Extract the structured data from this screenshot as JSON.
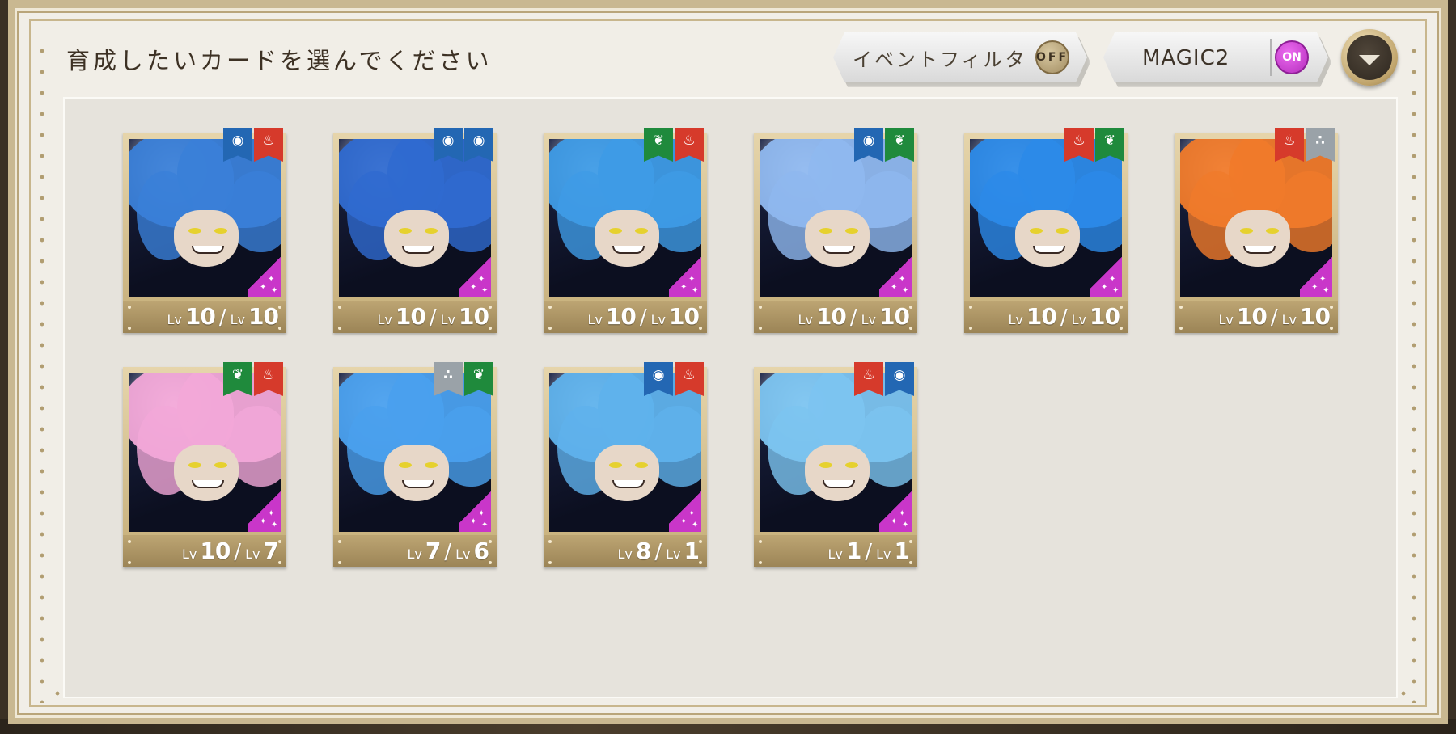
{
  "header": {
    "title": "育成したいカードを選んでください",
    "event_filter": {
      "label": "イベントフィルタ",
      "toggle": "OFF"
    },
    "magic_filter": {
      "label": "MAGIC2",
      "toggle": "ON"
    }
  },
  "colors": {
    "magic_blue": "#2367b3",
    "magic_red": "#d63a2b",
    "magic_green": "#1f8a3c",
    "magic_none": "#9aa2a8",
    "on_toggle": "#c936c9"
  },
  "cards": [
    {
      "level": "10",
      "max_level": "10",
      "lv1": "Lv",
      "lv2": "Lv",
      "badges": [
        "water",
        "fire"
      ],
      "hair": "#3a7fd8"
    },
    {
      "level": "10",
      "max_level": "10",
      "lv1": "Lv",
      "lv2": "Lv",
      "badges": [
        "water",
        "water"
      ],
      "hair": "#2f6ad0"
    },
    {
      "level": "10",
      "max_level": "10",
      "lv1": "Lv",
      "lv2": "Lv",
      "badges": [
        "flora",
        "fire"
      ],
      "hair": "#3e9be6"
    },
    {
      "level": "10",
      "max_level": "10",
      "lv1": "Lv",
      "lv2": "Lv",
      "badges": [
        "water",
        "flora"
      ],
      "hair": "#8fb8ef"
    },
    {
      "level": "10",
      "max_level": "10",
      "lv1": "Lv",
      "lv2": "Lv",
      "badges": [
        "fire",
        "flora"
      ],
      "hair": "#2c8ae8"
    },
    {
      "level": "10",
      "max_level": "10",
      "lv1": "Lv",
      "lv2": "Lv",
      "badges": [
        "fire",
        "cosmic"
      ],
      "hair": "#f07a2a"
    },
    {
      "level": "10",
      "max_level": "7",
      "lv1": "Lv",
      "lv2": "Lv",
      "badges": [
        "flora",
        "fire"
      ],
      "hair": "#f2a8d8"
    },
    {
      "level": "7",
      "max_level": "6",
      "lv1": "Lv",
      "lv2": "Lv",
      "badges": [
        "cosmic",
        "flora"
      ],
      "hair": "#4aa0ee"
    },
    {
      "level": "8",
      "max_level": "1",
      "lv1": "Lv",
      "lv2": "Lv",
      "badges": [
        "water",
        "fire"
      ],
      "hair": "#5fb2ec"
    },
    {
      "level": "1",
      "max_level": "1",
      "lv1": "Lv",
      "lv2": "Lv",
      "badges": [
        "fire",
        "water"
      ],
      "hair": "#7cc4f0"
    }
  ]
}
